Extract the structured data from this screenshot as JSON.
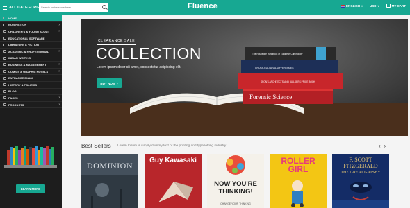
{
  "header": {
    "categories_label": "ALL CATEGORIES",
    "search_placeholder": "Search entire store here...",
    "logo": "Fluence",
    "language": "ENGLISH",
    "currency": "USD",
    "cart_label": "MY CART",
    "accent": "#17a892"
  },
  "sidebar": {
    "items": [
      {
        "label": "HOME",
        "chevron": false
      },
      {
        "label": "NON-FICTION",
        "chevron": true
      },
      {
        "label": "CHILDREN'S & YOUNG ADULT",
        "chevron": true
      },
      {
        "label": "EDUCATIONAL SOFTWARE",
        "chevron": false
      },
      {
        "label": "LIBRATURE & FICTION",
        "chevron": false
      },
      {
        "label": "ACADEMIC & PROFESSIONAL",
        "chevron": true
      },
      {
        "label": "INDIAN WRITING",
        "chevron": false
      },
      {
        "label": "BUSINESS & MANAGEMENT",
        "chevron": true
      },
      {
        "label": "COMICS & GRAPHIC NOVELS",
        "chevron": true
      },
      {
        "label": "ENTRANCE EXAM",
        "chevron": false
      },
      {
        "label": "HISTORY & POLITICS",
        "chevron": false
      },
      {
        "label": "BLOG",
        "chevron": false
      },
      {
        "label": "PAGES",
        "chevron": true
      },
      {
        "label": "PRODUCTS",
        "chevron": true
      }
    ],
    "learn_more": "LEARN MORE"
  },
  "banner": {
    "tag": "CLEARANCE SALE",
    "title": "COLLECTION",
    "description": "Lorem ipsum dolor sit amet, consectetur adipiscing elit.",
    "button": "BUY NOW",
    "spine_titles": [
      "The Routledge Handbook of European Criminology",
      "CROSS-CULTURAL DIFFERENCES",
      "SPON'S ARCHITECTS' AND BUILDERS PRICE BOOK",
      "Forensic Science"
    ]
  },
  "best_sellers": {
    "title": "Best Sellers",
    "description": "Lorem Ipsum is simply dummy text of the printing and typesetting industry.",
    "books": [
      {
        "title": "DOMINION",
        "subtitle": "",
        "bg": "#3a4550"
      },
      {
        "title": "Guy Kawasaki",
        "subtitle": "",
        "bg": "#b8262b"
      },
      {
        "title": "NOW YOU'RE THINKING!",
        "subtitle": "CHANGE YOUR THINKING",
        "bg": "#f4f1ea"
      },
      {
        "title": "ROLLER GIRL",
        "subtitle": "",
        "bg": "#f3c614"
      },
      {
        "title": "F. SCOTT FITZGERALD",
        "subtitle": "THE GREAT GATSBY",
        "bg": "#142c66"
      }
    ]
  }
}
